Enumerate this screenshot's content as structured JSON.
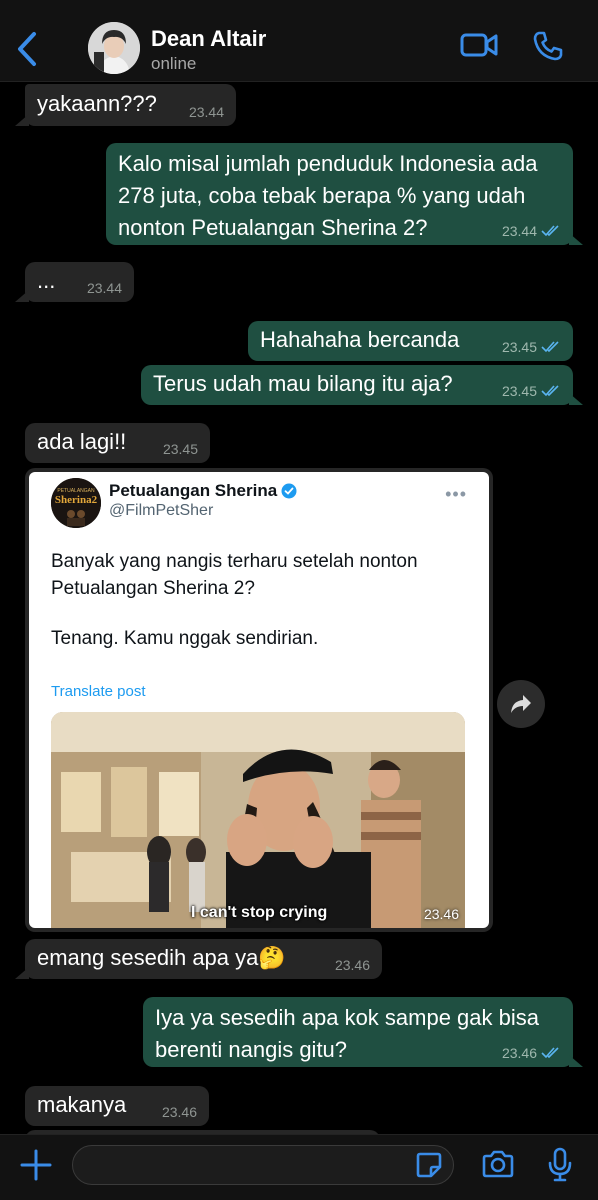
{
  "header": {
    "back_icon": "chevron-left-icon",
    "contact_name": "Dean Altair",
    "status": "online",
    "video_icon": "video-camera-icon",
    "call_icon": "phone-icon"
  },
  "messages": [
    {
      "dir": "in",
      "text": "yakaann???",
      "time": "23.44"
    },
    {
      "dir": "out",
      "text": "Kalo misal jumlah penduduk Indonesia ada 278 juta, coba tebak berapa % yang udah nonton Petualangan Sherina 2?",
      "time": "23.44",
      "read": true
    },
    {
      "dir": "in",
      "text": "...",
      "time": "23.44"
    },
    {
      "dir": "out",
      "text": "Hahahaha bercanda",
      "time": "23.45",
      "read": true
    },
    {
      "dir": "out",
      "text": "Terus udah mau bilang itu aja?",
      "time": "23.45",
      "read": true
    },
    {
      "dir": "in",
      "text": "ada lagi!!",
      "time": "23.45"
    },
    {
      "dir": "in",
      "text": "emang sesedih apa ya🤔",
      "time": "23.46"
    },
    {
      "dir": "out",
      "text": "Iya ya sesedih apa kok sampe gak bisa berenti nangis gitu?",
      "time": "23.46",
      "read": true
    },
    {
      "dir": "in",
      "text": "makanya",
      "time": "23.46"
    }
  ],
  "tweet": {
    "account_name": "Petualangan Sherina",
    "handle": "@FilmPetSher",
    "more": "•••",
    "avatar_text_top": "PETUALANGAN",
    "avatar_text_main": "Sherina2",
    "paragraph1": "Banyak yang nangis terharu setelah nonton Petualangan Sherina 2?",
    "paragraph2": "Tenang. Kamu nggak sendirian.",
    "translate": "Translate post",
    "caption": "I can't stop crying",
    "time": "23.46"
  },
  "composer": {
    "input_value": "",
    "input_placeholder": ""
  },
  "colors": {
    "incoming_bubble": "#262626",
    "outgoing_bubble": "#1f4f41",
    "accent": "#3a8ce8",
    "read_ticks": "#5ab4f0",
    "link": "#1d9bf0"
  }
}
